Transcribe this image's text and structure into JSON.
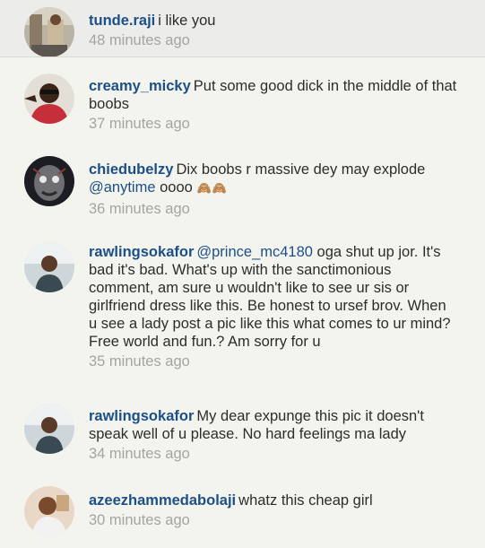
{
  "comments": [
    {
      "username": "tunde.raji",
      "text": "i like you",
      "time": "48 minutes ago",
      "avatar_icon": "avatar-photo-icon"
    },
    {
      "username": "creamy_micky",
      "text": "Put some good dick in the middle of that boobs",
      "time": "37 minutes ago",
      "avatar_icon": "avatar-photo-icon"
    },
    {
      "username": "chiedubelzy",
      "text": "Dix boobs r massive dey may explode",
      "mention": "@anytime",
      "text_after": "oooo",
      "emoji": "🙈🙈",
      "time": "36 minutes ago",
      "avatar_icon": "avatar-photo-icon"
    },
    {
      "username": "rawlingsokafor",
      "mention": "@prince_mc4180",
      "text": "oga shut up jor. It's bad it's bad. What's up with the sanctimonious comment, am sure u wouldn't like to see ur sis or girlfriend dress like this. Be honest to ursef brov. When u see a lady post a pic like this what comes to ur mind? Free world and fun.? Am sorry for u",
      "time": "35 minutes ago",
      "avatar_icon": "avatar-photo-icon"
    },
    {
      "username": "rawlingsokafor",
      "text": "My dear expunge this pic it doesn't speak well of u please. No hard feelings ma lady",
      "time": "34 minutes ago",
      "avatar_icon": "avatar-photo-icon"
    },
    {
      "username": "azeezhammedabolaji",
      "text": "whatz this cheap girl",
      "time": "30 minutes ago",
      "avatar_icon": "avatar-photo-icon"
    }
  ]
}
